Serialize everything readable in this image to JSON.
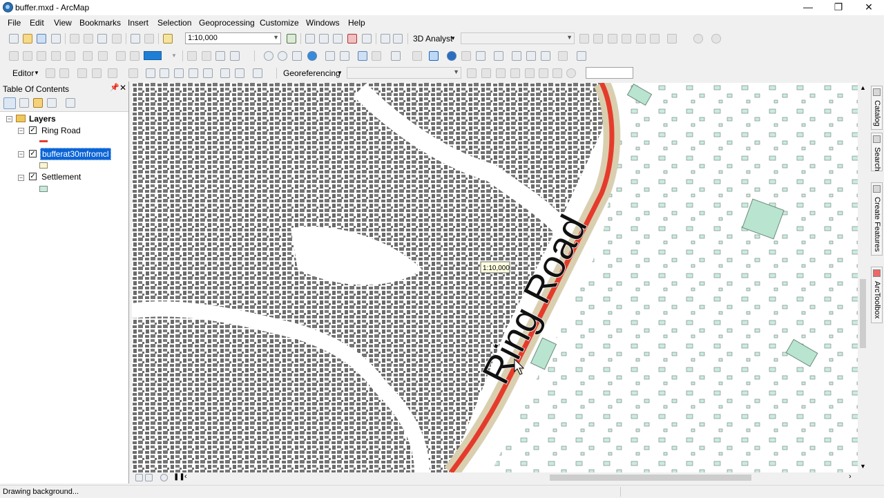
{
  "window": {
    "title": "buffer.mxd - ArcMap",
    "min_glyph": "—",
    "restore_glyph": "❐",
    "close_glyph": "✕"
  },
  "menu": [
    "File",
    "Edit",
    "View",
    "Bookmarks",
    "Insert",
    "Selection",
    "Geoprocessing",
    "Customize",
    "Windows",
    "Help"
  ],
  "standard_toolbar": {
    "scale_value": "1:10,000",
    "analyst_label": "3D Analyst",
    "analyst_layer": ""
  },
  "editor_toolbar": {
    "editor_label": "Editor",
    "georef_label": "Georeferencing",
    "georef_layer": "",
    "georef_scale": ""
  },
  "toc": {
    "title": "Table Of Contents",
    "group": "Layers",
    "layers": [
      {
        "name": "Ring Road",
        "checked": true,
        "symbol_color": "#e53b2c",
        "symbol": "line"
      },
      {
        "name": "bufferat30mfromcl",
        "checked": true,
        "selected": true,
        "symbol_color": "#fbf5d2",
        "symbol": "polygon"
      },
      {
        "name": "Settlement",
        "checked": true,
        "symbol_color": "#c7eadc",
        "symbol": "polygon"
      }
    ]
  },
  "map": {
    "road_label": "Ring Road",
    "scale_tip": "1:10,000",
    "road_color": "#e53b2c",
    "buffer_color": "#f3e6c0",
    "dense_building_color": "#6e6e6e",
    "settlement_color": "#b9e4d0"
  },
  "side_tabs": [
    "Catalog",
    "Search",
    "Create Features",
    "ArcToolbox"
  ],
  "status": {
    "text": "Drawing background..."
  }
}
